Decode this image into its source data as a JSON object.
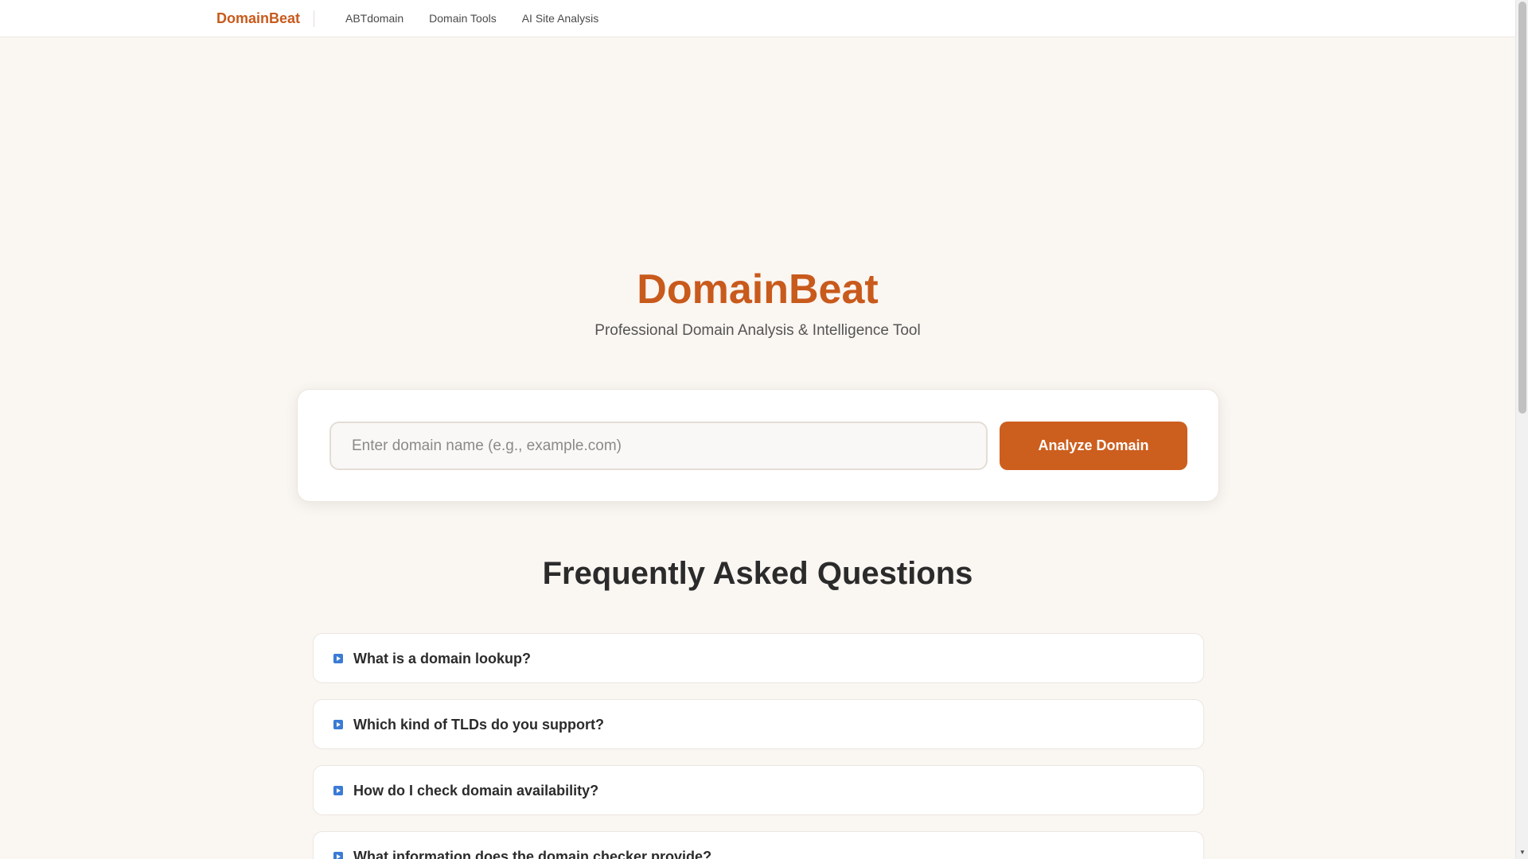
{
  "nav": {
    "brand": "DomainBeat",
    "links": [
      "ABTdomain",
      "Domain Tools",
      "AI Site Analysis"
    ]
  },
  "hero": {
    "title": "DomainBeat",
    "subtitle": "Professional Domain Analysis & Intelligence Tool"
  },
  "search": {
    "placeholder": "Enter domain name (e.g., example.com)",
    "value": "",
    "button_label": "Analyze Domain"
  },
  "faq": {
    "title": "Frequently Asked Questions",
    "items": [
      {
        "question": "What is a domain lookup?",
        "icon": "play-icon"
      },
      {
        "question": "Which kind of TLDs do you support?",
        "icon": "play-icon"
      },
      {
        "question": "How do I check domain availability?",
        "icon": "play-icon"
      },
      {
        "question": "What information does the domain checker provide?",
        "icon": "play-icon"
      }
    ]
  },
  "colors": {
    "brand": "#c85a1c",
    "button": "#cc5e1e",
    "background": "#faf6f2",
    "faq_icon": "#3a7bd5"
  }
}
